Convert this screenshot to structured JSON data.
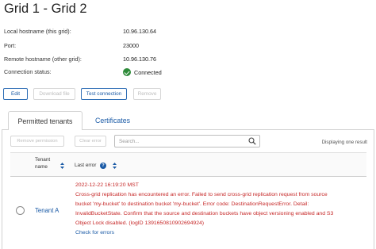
{
  "page": {
    "title": "Grid 1 - Grid 2"
  },
  "info": [
    {
      "label": "Local hostname (this grid):",
      "value": "10.96.130.64"
    },
    {
      "label": "Port:",
      "value": "23000"
    },
    {
      "label": "Remote hostname (other grid):",
      "value": "10.96.130.76"
    },
    {
      "label": "Connection status:",
      "value": "Connected",
      "icon": "check-circle-icon",
      "status_color": "#2e8b3a"
    }
  ],
  "actions": {
    "edit": "Edit",
    "download": "Download file",
    "test": "Test connection",
    "remove": "Remove"
  },
  "tabs": {
    "permitted": "Permitted tenants",
    "certificates": "Certificates"
  },
  "toolbar": {
    "remove_permission": "Remove permission",
    "clear_error": "Clear error",
    "search_placeholder": "Search...",
    "search_icon": "search-icon",
    "displaying": "Displaying one result"
  },
  "table": {
    "columns": {
      "tenant_line1": "Tenant",
      "tenant_line2": "name",
      "last_error": "Last error",
      "help_glyph": "?"
    },
    "rows": [
      {
        "tenant": "Tenant A",
        "error_lines": [
          "2022-12-22 16:19:20 MST",
          "Cross-grid replication has encountered an error. Failed to send cross-grid replication request from source",
          "bucket 'my-bucket' to destination bucket 'my-bucket'. Error code: DestinationRequestError. Detail:",
          "InvalidBucketState. Confirm that the source and destination buckets have object versioning enabled and S3",
          "Object Lock disabled. (logID 1391650810902694924)"
        ],
        "link": "Check for errors"
      }
    ]
  },
  "colors": {
    "link": "#1a5aa6",
    "error": "#c62828",
    "success": "#2e8b3a"
  }
}
